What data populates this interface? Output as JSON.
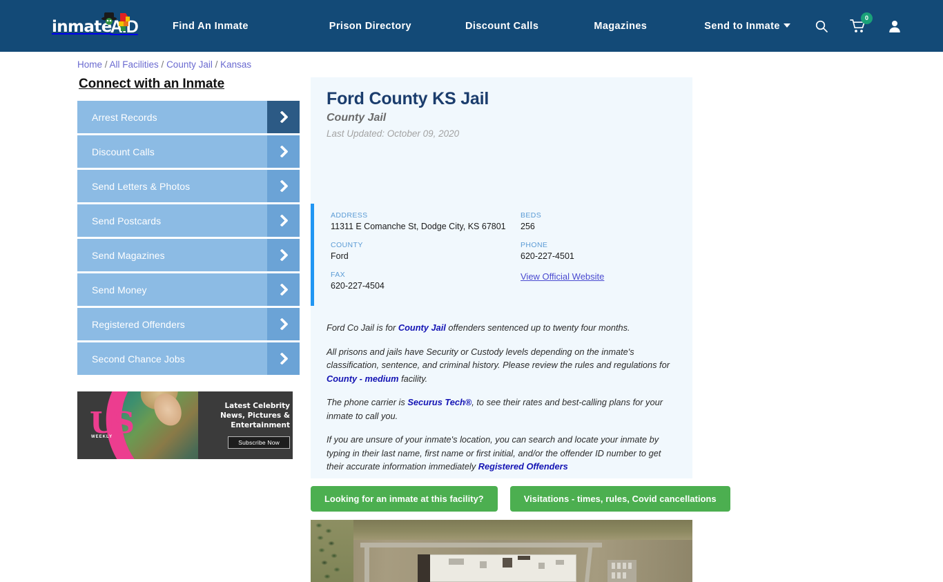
{
  "header": {
    "brand": "inmate",
    "brand_accent": "AID",
    "nav": [
      {
        "label": "Find An Inmate",
        "has_caret": false
      },
      {
        "label": "Prison Directory",
        "has_caret": false
      },
      {
        "label": "Discount Calls",
        "has_caret": false
      },
      {
        "label": "Magazines",
        "has_caret": false
      },
      {
        "label": "Send to Inmate",
        "has_caret": true
      }
    ],
    "search_icon": "search-icon",
    "cart_icon": "shopping-cart-icon",
    "cart_count": "0",
    "account_icon": "user-account-icon",
    "bg_color": "#134a77"
  },
  "breadcrumb": {
    "items": [
      "Home",
      "All Facilities",
      "County Jail",
      "Kansas"
    ],
    "separator": "/"
  },
  "sidebar": {
    "title": "Connect with an Inmate",
    "items": [
      {
        "label": "Arrest Records",
        "active": true
      },
      {
        "label": "Discount Calls",
        "active": false
      },
      {
        "label": "Send Letters & Photos",
        "active": false
      },
      {
        "label": "Send Postcards",
        "active": false
      },
      {
        "label": "Send Magazines",
        "active": false
      },
      {
        "label": "Send Money",
        "active": false
      },
      {
        "label": "Registered Offenders",
        "active": false
      },
      {
        "label": "Second Chance Jobs",
        "active": false
      }
    ]
  },
  "ad": {
    "brand": "US",
    "brand_sub": "WEEKLY",
    "line1": "Latest Celebrity",
    "line2": "News, Pictures &",
    "line3": "Entertainment",
    "button": "Subscribe Now"
  },
  "facility": {
    "title": "Ford County KS Jail",
    "subtitle": "County Jail",
    "last_updated": "Last Updated: October 09, 2020",
    "fields": [
      {
        "label": "ADDRESS",
        "value": "11311 E Comanche St, Dodge City, KS 67801"
      },
      {
        "label": "BEDS",
        "value": "256"
      },
      {
        "label": "COUNTY",
        "value": "Ford"
      },
      {
        "label": "PHONE",
        "value": "620-227-4501"
      },
      {
        "label": "FAX",
        "value": "620-227-4504"
      }
    ],
    "official_website_link": "View Official Website",
    "paragraphs": [
      {
        "parts": [
          {
            "text": "Ford Co Jail is for ",
            "link": false
          },
          {
            "text": "County Jail",
            "link": true
          },
          {
            "text": " offenders sentenced up to twenty four months.",
            "link": false
          }
        ]
      },
      {
        "parts": [
          {
            "text": "All prisons and jails have Security or Custody levels depending on the inmate's classification, sentence, and criminal history. Please review the rules and regulations for ",
            "link": false
          },
          {
            "text": "County - medium",
            "link": true
          },
          {
            "text": " facility.",
            "link": false
          }
        ]
      },
      {
        "parts": [
          {
            "text": "The phone carrier is ",
            "link": false
          },
          {
            "text": "Securus Tech®",
            "link": true
          },
          {
            "text": ", to see their rates and best-calling plans for your inmate to call you.",
            "link": false
          }
        ]
      },
      {
        "parts": [
          {
            "text": "If you are unsure of your inmate's location, you can search and locate your inmate by typing in their last name, first name or first initial, and/or the offender ID number to get their accurate information immediately ",
            "link": false
          },
          {
            "text": "Registered Offenders",
            "link": true
          }
        ]
      }
    ]
  },
  "cta_buttons": [
    {
      "label": "Looking for an inmate at this facility?"
    },
    {
      "label": "Visitations - times, rules, Covid cancellations"
    }
  ],
  "satellite": {
    "alt": "Aerial satellite view of Ford County KS Jail facility"
  },
  "colors": {
    "header_bg": "#134a77",
    "card_bg": "#f1f8fd",
    "accent_bar": "#2196f3",
    "sidebar_btn": "#8cbbe4",
    "sidebar_arrow": "#6ba3d6",
    "sidebar_arrow_active": "#2c5a85",
    "cta_green": "#4caf50",
    "link_blue": "#1414b4",
    "title_navy": "#1b3d6d",
    "badge_green": "#1aa179"
  }
}
